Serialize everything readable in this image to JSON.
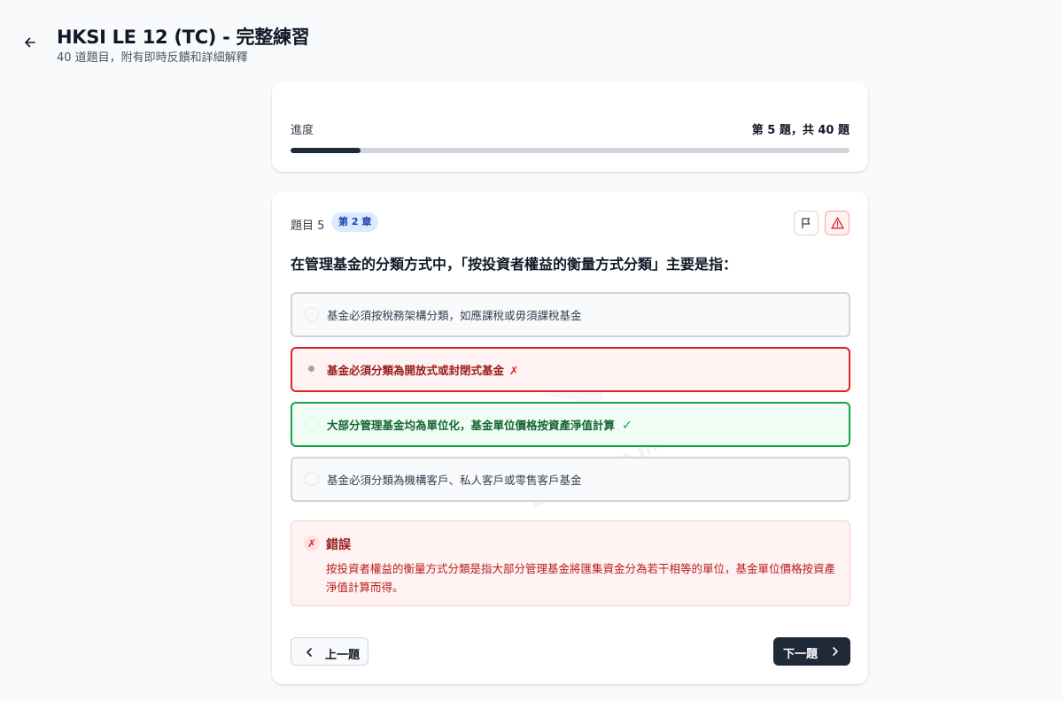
{
  "header": {
    "title": "HKSI LE 12 (TC) - 完整練習",
    "subtitle": "40 道題目，附有即時反饋和詳細解釋",
    "back_icon": "arrow-left-icon"
  },
  "progress": {
    "label": "進度",
    "count_text": "第 5 題，共 40 題",
    "current": 5,
    "total": 40,
    "fraction": 0.125
  },
  "question": {
    "number_label": "題目 5",
    "chapter_badge": "第 2 章",
    "text": "在管理基金的分類方式中，「按投資者權益的衡量方式分類」主要是指：",
    "flag_icon": "flag-icon",
    "report_icon": "alert-triangle-icon",
    "options": [
      {
        "text": "基金必須按稅務架構分類，如應課稅或毋須課稅基金",
        "state": "default"
      },
      {
        "text": "基金必須分類為開放式或封閉式基金",
        "state": "wrong",
        "mark": "✗"
      },
      {
        "text": "大部分管理基金均為單位化，基金單位價格按資產淨值計算",
        "state": "correct",
        "mark": "✓"
      },
      {
        "text": "基金必須分類為機構客戶、私人客戶或零售客戶基金",
        "state": "default"
      }
    ]
  },
  "feedback": {
    "icon": "✗",
    "title": "錯誤",
    "text": "按投資者權益的衡量方式分類是指大部分管理基金將匯集資金分為若干相等的單位，基金單位價格按資產淨值計算而得。"
  },
  "navigation": {
    "prev_label": "上一題",
    "next_label": "下一題"
  },
  "watermark": "ExamPrep.hk",
  "colors": {
    "primary": "#1f2937",
    "badge_bg": "#dbeafe",
    "badge_text": "#1e40af",
    "wrong": "#dc2626",
    "correct": "#16a34a"
  }
}
